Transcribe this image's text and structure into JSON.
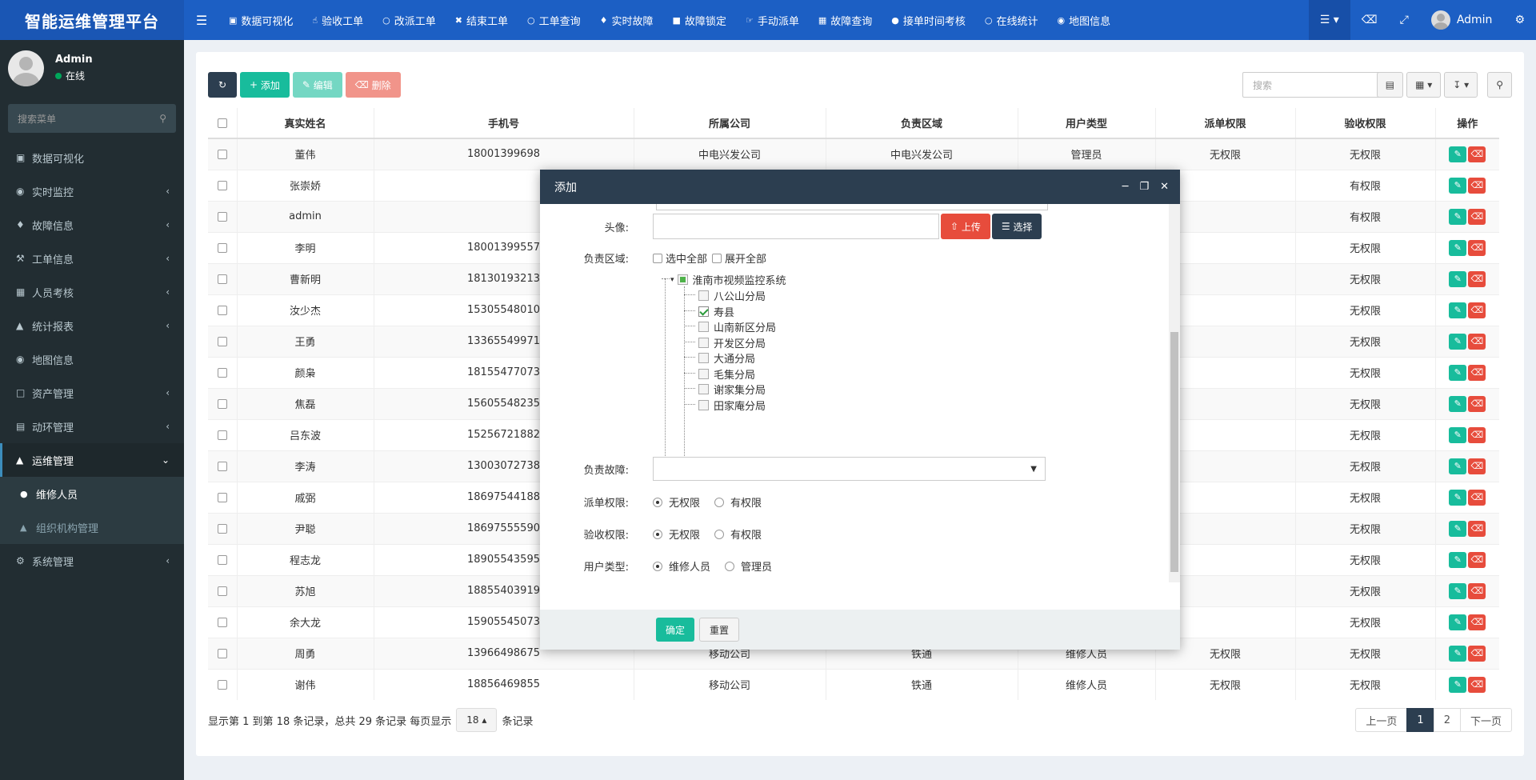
{
  "app": {
    "title": "智能运维管理平台"
  },
  "topnav": [
    {
      "label": "数据可视化",
      "icon": "dashboard-icon"
    },
    {
      "label": "验收工单",
      "icon": "thumbs-up-icon"
    },
    {
      "label": "改派工单",
      "icon": "circle-icon"
    },
    {
      "label": "结束工单",
      "icon": "close-icon"
    },
    {
      "label": "工单查询",
      "icon": "circle-icon"
    },
    {
      "label": "实时故障",
      "icon": "bell-icon"
    },
    {
      "label": "故障锁定",
      "icon": "lock-icon"
    },
    {
      "label": "手动派单",
      "icon": "hand-icon"
    },
    {
      "label": "故障查询",
      "icon": "keyboard-icon"
    },
    {
      "label": "接单时间考核",
      "icon": "user-icon"
    },
    {
      "label": "在线统计",
      "icon": "circle-icon"
    },
    {
      "label": "地图信息",
      "icon": "map-marker-icon"
    }
  ],
  "topright": {
    "username": "Admin"
  },
  "sidebar": {
    "user": {
      "name": "Admin",
      "status": "在线"
    },
    "search_placeholder": "搜索菜单",
    "menu": [
      {
        "label": "数据可视化",
        "icon": "dashboard-icon",
        "has_children": false
      },
      {
        "label": "实时监控",
        "icon": "binoculars-icon",
        "has_children": true
      },
      {
        "label": "故障信息",
        "icon": "bell-icon",
        "has_children": true
      },
      {
        "label": "工单信息",
        "icon": "wrench-icon",
        "has_children": true
      },
      {
        "label": "人员考核",
        "icon": "table-icon",
        "has_children": true
      },
      {
        "label": "统计报表",
        "icon": "area-chart-icon",
        "has_children": true
      },
      {
        "label": "地图信息",
        "icon": "map-marker-icon",
        "has_children": false
      },
      {
        "label": "资产管理",
        "icon": "folder-open-icon",
        "has_children": true
      },
      {
        "label": "动环管理",
        "icon": "monitor-icon",
        "has_children": true
      }
    ],
    "open_menu": {
      "label": "运维管理",
      "icon": "bank-icon"
    },
    "sub_menu": [
      {
        "label": "维修人员",
        "icon": "user-icon",
        "active": true
      },
      {
        "label": "组织机构管理",
        "icon": "sitemap-icon",
        "active": false
      }
    ],
    "last_menu": {
      "label": "系统管理",
      "icon": "cogs-icon"
    }
  },
  "toolbar": {
    "add_label": "添加",
    "edit_label": "编辑",
    "delete_label": "删除",
    "search_placeholder": "搜索"
  },
  "table": {
    "columns": [
      "真实姓名",
      "手机号",
      "所属公司",
      "负责区域",
      "用户类型",
      "派单权限",
      "验收权限",
      "操作"
    ],
    "rows": [
      [
        "董伟",
        "18001399698",
        "中电兴发公司",
        "中电兴发公司",
        "管理员",
        "无权限",
        "无权限"
      ],
      [
        "张崇娇",
        "",
        "",
        "",
        "",
        "",
        "有权限"
      ],
      [
        "admin",
        "",
        "",
        "",
        "",
        "",
        "有权限"
      ],
      [
        "李明",
        "18001399557",
        "",
        "",
        "",
        "",
        "无权限"
      ],
      [
        "曹新明",
        "18130193213",
        "",
        "",
        "",
        "",
        "无权限"
      ],
      [
        "汝少杰",
        "15305548010",
        "",
        "",
        "",
        "",
        "无权限"
      ],
      [
        "王勇",
        "13365549971",
        "",
        "",
        "",
        "",
        "无权限"
      ],
      [
        "颜枭",
        "18155477073",
        "",
        "",
        "",
        "",
        "无权限"
      ],
      [
        "焦磊",
        "15605548235",
        "",
        "",
        "",
        "",
        "无权限"
      ],
      [
        "吕东波",
        "15256721882",
        "",
        "",
        "",
        "",
        "无权限"
      ],
      [
        "李涛",
        "13003072738",
        "",
        "",
        "",
        "",
        "无权限"
      ],
      [
        "戚弼",
        "18697544188",
        "",
        "",
        "",
        "",
        "无权限"
      ],
      [
        "尹聪",
        "18697555590",
        "",
        "",
        "",
        "",
        "无权限"
      ],
      [
        "程志龙",
        "18905543595",
        "",
        "",
        "",
        "",
        "无权限"
      ],
      [
        "苏旭",
        "18855403919",
        "",
        "",
        "",
        "",
        "无权限"
      ],
      [
        "余大龙",
        "15905545073",
        "",
        "",
        "",
        "",
        "无权限"
      ],
      [
        "周勇",
        "13966498675",
        "移动公司",
        "铁通",
        "维修人员",
        "无权限",
        "无权限"
      ],
      [
        "谢伟",
        "18856469855",
        "移动公司",
        "铁通",
        "维修人员",
        "无权限",
        "无权限"
      ]
    ]
  },
  "pagination": {
    "info_prefix": "显示第 1 到第 18 条记录，总共 29 条记录 每页显示",
    "page_size": "18",
    "info_suffix": "条记录",
    "prev": "上一页",
    "pages": [
      "1",
      "2"
    ],
    "current": "1",
    "next": "下一页"
  },
  "modal": {
    "title": "添加",
    "avatar_label": "头像:",
    "upload_label": "上传",
    "choose_label": "选择",
    "area_label": "负责区域:",
    "select_all": "选中全部",
    "expand_all": "展开全部",
    "tree_root": "淮南市视频监控系统",
    "tree_children": [
      {
        "label": "八公山分局",
        "checked": false
      },
      {
        "label": "寿县",
        "checked": true
      },
      {
        "label": "山南新区分局",
        "checked": false
      },
      {
        "label": "开发区分局",
        "checked": false
      },
      {
        "label": "大通分局",
        "checked": false
      },
      {
        "label": "毛集分局",
        "checked": false
      },
      {
        "label": "谢家集分局",
        "checked": false
      },
      {
        "label": "田家庵分局",
        "checked": false
      }
    ],
    "fault_label": "负责故障:",
    "dispatch_label": "派单权限:",
    "accept_label": "验收权限:",
    "usertype_label": "用户类型:",
    "opt_none": "无权限",
    "opt_has": "有权限",
    "opt_repair": "维修人员",
    "opt_admin": "管理员",
    "ok_label": "确定",
    "reset_label": "重置"
  },
  "colors": {
    "header": "#1c5fc4",
    "sidebar": "#222d32",
    "primary_dark": "#2c3e50",
    "success": "#18bc9c",
    "danger": "#e74c3c"
  }
}
